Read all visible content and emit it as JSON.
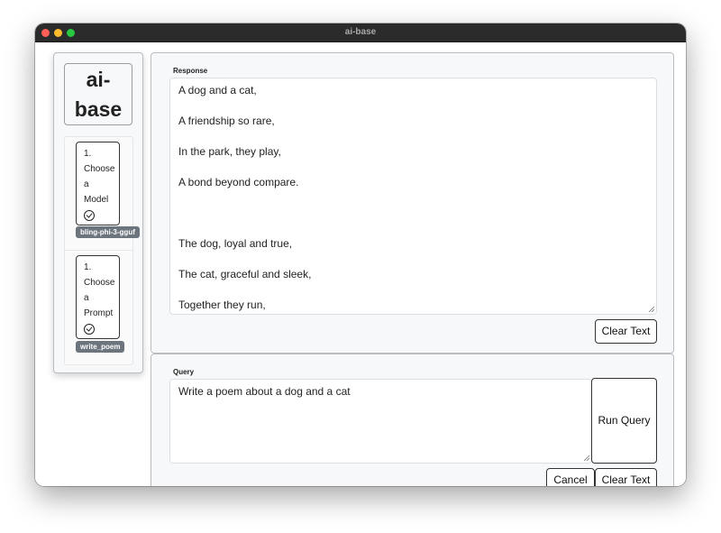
{
  "window": {
    "title": "ai-base"
  },
  "sidebar": {
    "logo": [
      "ai-",
      "base"
    ],
    "steps": [
      {
        "lines": [
          "1.",
          "Choose",
          "a",
          "Model"
        ],
        "badge": "bling-phi-3-gguf",
        "check_icon": "check-circle-icon"
      },
      {
        "lines": [
          "1.",
          "Choose",
          "a",
          "Prompt"
        ],
        "badge": "write_poem",
        "check_icon": "check-circle-icon"
      }
    ]
  },
  "response": {
    "label": "Response",
    "lines": [
      "A dog and a cat,",
      "A friendship so rare,",
      "In the park, they play,",
      "A bond beyond compare.",
      "",
      "The dog, loyal and true,",
      "The cat, graceful and sleek,",
      "Together they run,"
    ],
    "clear_button": "Clear Text"
  },
  "query": {
    "label": "Query",
    "value": "Write a poem about a dog and a cat",
    "run_button": "Run Query",
    "cancel_button": "Cancel",
    "clear_button": "Clear Text"
  },
  "colors": {
    "titlebar": "#2b2b2b",
    "panel_bg": "#f7f8f9",
    "badge_bg": "#6c757d"
  }
}
